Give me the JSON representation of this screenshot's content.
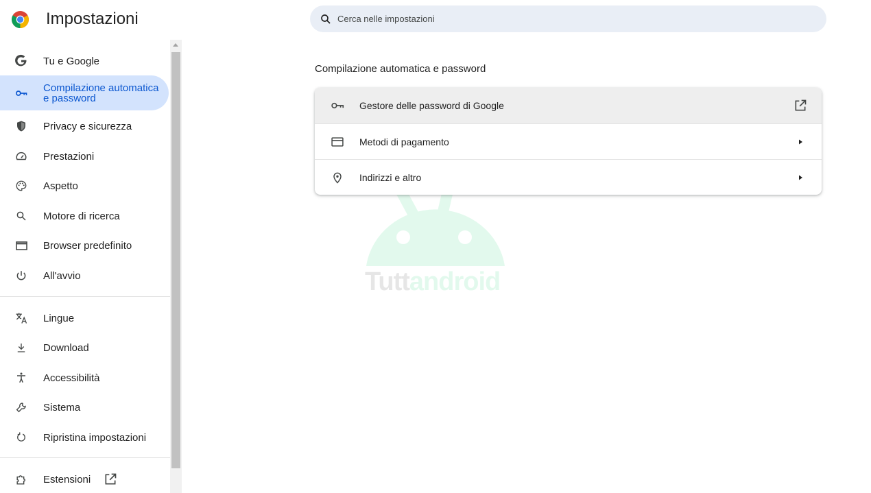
{
  "header": {
    "title": "Impostazioni",
    "search_placeholder": "Cerca nelle impostazioni"
  },
  "sidebar": {
    "items": [
      {
        "label": "Tu e Google",
        "icon": "google-g-icon"
      },
      {
        "label": "Compilazione automatica e password",
        "icon": "key-icon",
        "active": true
      },
      {
        "label": "Privacy e sicurezza",
        "icon": "shield-icon"
      },
      {
        "label": "Prestazioni",
        "icon": "speedometer-icon"
      },
      {
        "label": "Aspetto",
        "icon": "palette-icon"
      },
      {
        "label": "Motore di ricerca",
        "icon": "search-icon"
      },
      {
        "label": "Browser predefinito",
        "icon": "browser-window-icon"
      },
      {
        "label": "All'avvio",
        "icon": "power-icon"
      },
      {
        "label": "Lingue",
        "icon": "translate-icon"
      },
      {
        "label": "Download",
        "icon": "download-icon"
      },
      {
        "label": "Accessibilità",
        "icon": "accessibility-icon"
      },
      {
        "label": "Sistema",
        "icon": "wrench-icon"
      },
      {
        "label": "Ripristina impostazioni",
        "icon": "reset-icon"
      },
      {
        "label": "Estensioni",
        "icon": "puzzle-icon",
        "trailing_icon": "open-in-new-icon"
      }
    ]
  },
  "main": {
    "section_title": "Compilazione automatica e password",
    "rows": [
      {
        "label": "Gestore delle password di Google",
        "icon": "key-icon",
        "trailing_icon": "open-in-new-icon"
      },
      {
        "label": "Metodi di pagamento",
        "icon": "credit-card-icon",
        "trailing_icon": "arrow-right-icon"
      },
      {
        "label": "Indirizzi e altro",
        "icon": "location-pin-icon",
        "trailing_icon": "arrow-right-icon"
      }
    ]
  },
  "watermark": {
    "text_part1": "Tutt",
    "text_part2": "android"
  },
  "colors": {
    "accent": "#0b57d0",
    "active_bg": "#d3e3fd",
    "search_bg": "#e9eef6",
    "icon": "#444746"
  }
}
